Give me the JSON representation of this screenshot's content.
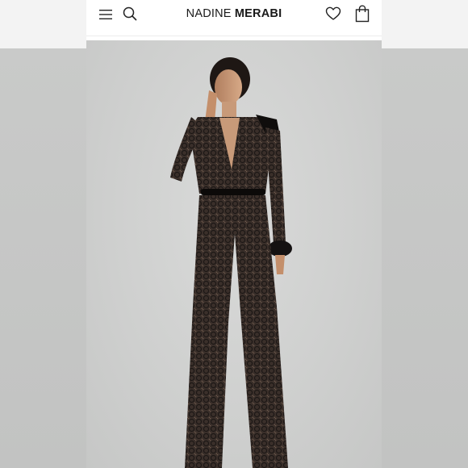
{
  "header": {
    "brand_first": "NADINE",
    "brand_last": "MERABI",
    "icons": {
      "menu": "hamburger-menu-icon",
      "search": "search-icon",
      "wishlist": "heart-icon",
      "cart": "shopping-bag-icon"
    }
  },
  "product_image": {
    "subject": "model-in-sequin-jumpsuit",
    "colors": {
      "garment": "#2a2320",
      "lining": "#8a6e5c",
      "background": "#cfd0cf"
    }
  }
}
